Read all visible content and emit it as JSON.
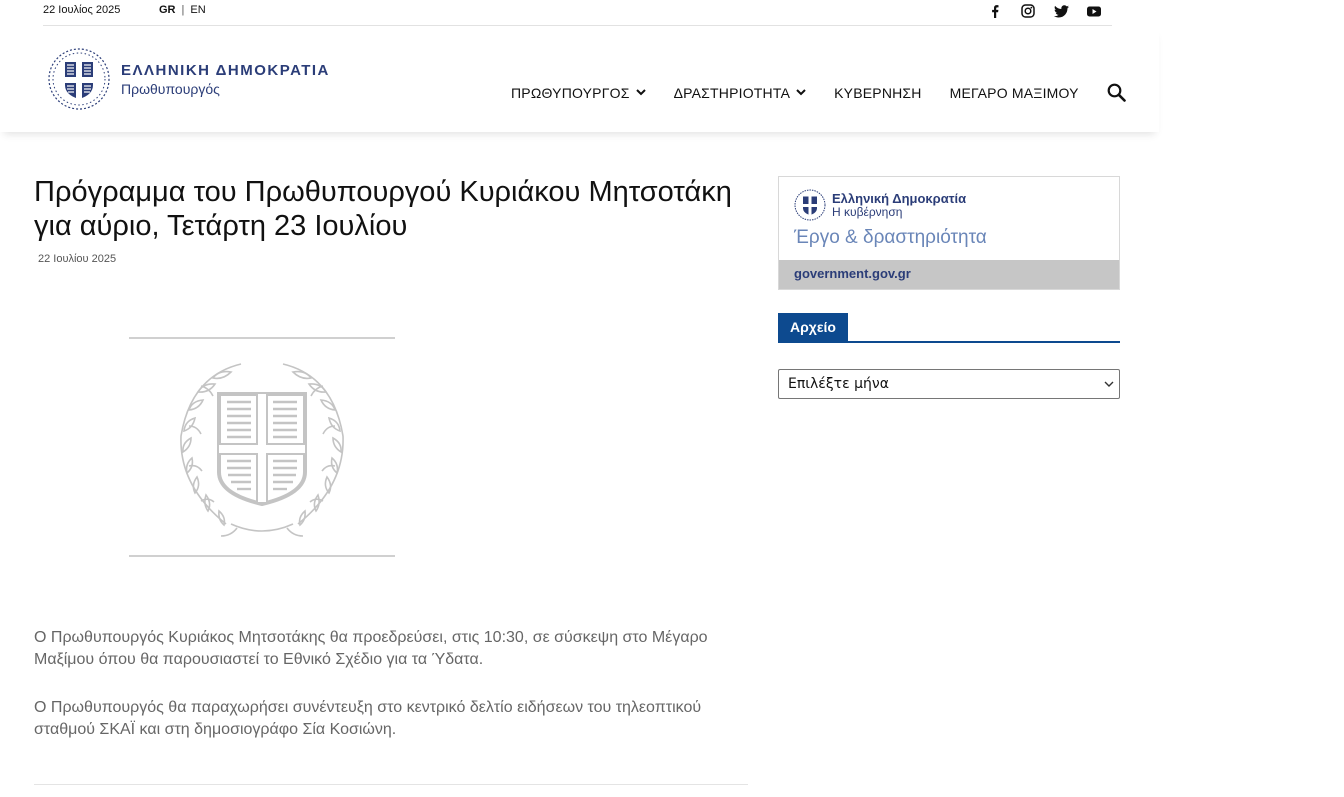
{
  "topbar": {
    "date": "22 Ιουλίος 2025",
    "lang_gr": "GR",
    "lang_sep": "|",
    "lang_en": "EN",
    "social_icons": [
      "facebook-icon",
      "instagram-icon",
      "twitter-icon",
      "youtube-icon"
    ]
  },
  "header": {
    "logo_title": "ΕΛΛΗΝΙΚΗ ΔΗΜΟΚΡΑΤΙΑ",
    "logo_subtitle": "Πρωθυπουργός",
    "nav": [
      {
        "label": "ΠΡΩΘΥΠΟΥΡΓΟΣ",
        "dropdown": true
      },
      {
        "label": "ΔΡΑΣΤΗΡΙΟΤΗΤΑ",
        "dropdown": true
      },
      {
        "label": "ΚΥΒΕΡΝΗΣΗ",
        "dropdown": false
      },
      {
        "label": "ΜΕΓΑΡΟ ΜΑΞΙΜΟΥ",
        "dropdown": false
      }
    ]
  },
  "article": {
    "title": "Πρόγραμμα του Πρωθυπουργού Κυριάκου Μητσοτάκη για αύριο, Τετάρτη 23 Ιουλίου",
    "date": "22 Ιουλίου 2025",
    "paragraphs": [
      "Ο Πρωθυπουργός Κυριάκος Μητσοτάκης θα προεδρεύσει, στις 10:30, σε σύσκεψη στο Μέγαρο Μαξίμου όπου θα παρουσιαστεί το Εθνικό Σχέδιο για τα Ύδατα.",
      "Ο Πρωθυπουργός θα παραχωρήσει συνέντευξη στο κεντρικό δελτίο ειδήσεων του τηλεοπτικού σταθμού ΣΚΑΪ και στη δημοσιογράφο Σία Κοσιώνη."
    ]
  },
  "sidebar": {
    "banner_title": "Ελληνική Δημοκρατία",
    "banner_subtitle": "Η κυβέρνηση",
    "banner_tagline": "Έργο & δραστηριότητα",
    "banner_url": "government.gov.gr",
    "archive_label": "Αρχείο",
    "month_select_value": "Επιλέξτε μήνα"
  },
  "colors": {
    "brand_blue": "#2b3d78",
    "archive_blue": "#0d4a8f",
    "banner_footer_gray": "#c6c6c6"
  }
}
